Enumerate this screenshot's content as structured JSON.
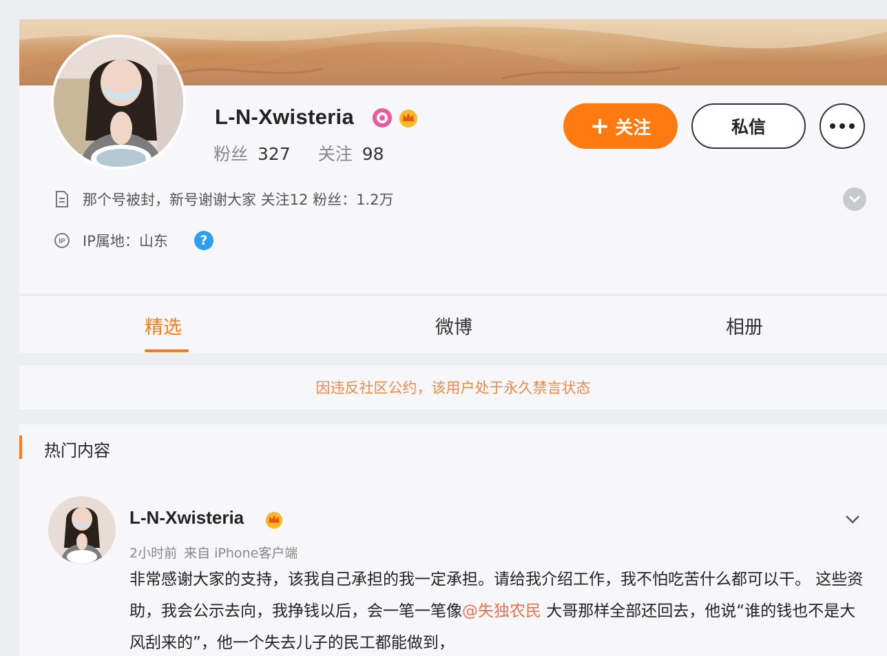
{
  "profile": {
    "username": "L-N-Xwisteria",
    "fans_label": "粉丝",
    "fans_count": "327",
    "follow_label": "关注",
    "follow_count": "98",
    "follow_button": "关注",
    "message_button": "私信",
    "description": "那个号被封，新号谢谢大家 关注12 粉丝：1.2万",
    "ip_location": "IP属地：山东",
    "help_symbol": "?"
  },
  "tabs": [
    {
      "label": "精选",
      "active": true
    },
    {
      "label": "微博",
      "active": false
    },
    {
      "label": "相册",
      "active": false
    }
  ],
  "notice": {
    "text": "因违反社区公约，该用户处于永久禁言状态"
  },
  "hot": {
    "title": "热门内容",
    "post": {
      "username": "L-N-Xwisteria",
      "time": "2小时前",
      "source": "来自 iPhone客户端",
      "text_part1": "非常感谢大家的支持，该我自己承担的我一定承担。请给我介绍工作，我不怕吃苦什么都可以干。 这些资助，我会公示去向，我挣钱以后，会一笔一笔像",
      "mention": "@失独农民",
      "text_part2": " 大哥那样全部还回去，他说“谁的钱也不是大风刮来的”，他一个失去儿子的民工都能做到，"
    }
  },
  "icons": {
    "description": "document-icon",
    "ip": "ip-location-icon",
    "expand": "chevron-down-icon",
    "more": "more-dots-icon",
    "svip": "svip-badge-icon",
    "crown": "crown-badge-icon"
  },
  "colors": {
    "accent": "#ff7b12",
    "notice": "#ef8a4a",
    "mention": "#eb7350",
    "help": "#2d9ef0"
  }
}
